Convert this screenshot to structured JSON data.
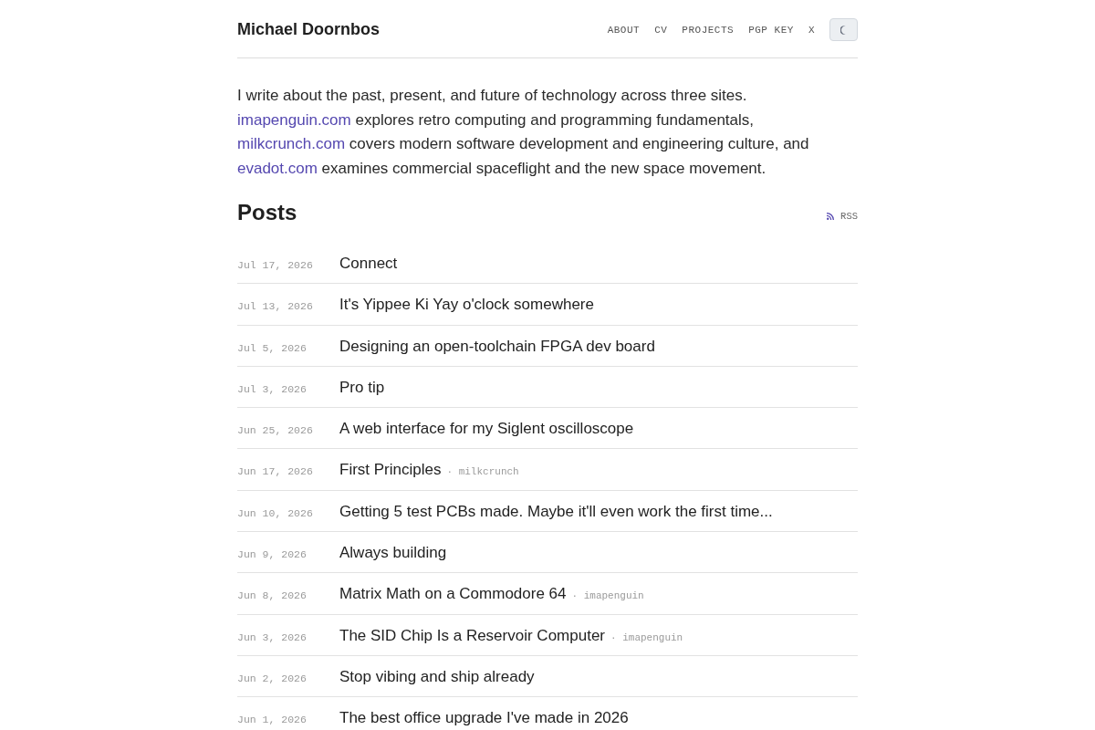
{
  "header": {
    "site_title": "Michael Doornbos",
    "nav": [
      {
        "label": "ABOUT"
      },
      {
        "label": "CV"
      },
      {
        "label": "PROJECTS"
      },
      {
        "label": "PGP KEY"
      },
      {
        "label": "X"
      }
    ]
  },
  "intro": [
    {
      "kind": "text",
      "text": "I write about the past, present, and future of technology across three sites. "
    },
    {
      "kind": "link",
      "text": "imapenguin.com"
    },
    {
      "kind": "text",
      "text": " explores retro computing and programming fundamentals, "
    },
    {
      "kind": "link",
      "text": "milkcrunch.com"
    },
    {
      "kind": "text",
      "text": " covers modern software development and engineering culture, and "
    },
    {
      "kind": "link",
      "text": "evadot.com"
    },
    {
      "kind": "text",
      "text": " examines commercial spaceflight and the new space movement."
    }
  ],
  "posts_section": {
    "title": "Posts",
    "rss_label": "RSS",
    "posts": [
      {
        "date": "Jul 17, 2026",
        "title": "Connect"
      },
      {
        "date": "Jul 13, 2026",
        "title": "It's Yippee Ki Yay o'clock somewhere"
      },
      {
        "date": "Jul 5, 2026",
        "title": "Designing an open-toolchain FPGA dev board"
      },
      {
        "date": "Jul 3, 2026",
        "title": "Pro tip"
      },
      {
        "date": "Jun 25, 2026",
        "title": "A web interface for my Siglent oscilloscope"
      },
      {
        "date": "Jun 17, 2026",
        "title": "First Principles",
        "site_tag": "· milkcrunch"
      },
      {
        "date": "Jun 10, 2026",
        "title": "Getting 5 test PCBs made. Maybe it'll even work the first time..."
      },
      {
        "date": "Jun 9, 2026",
        "title": "Always building"
      },
      {
        "date": "Jun 8, 2026",
        "title": "Matrix Math on a Commodore 64",
        "site_tag": "· imapenguin"
      },
      {
        "date": "Jun 3, 2026",
        "title": "The SID Chip Is a Reservoir Computer",
        "site_tag": "· imapenguin"
      },
      {
        "date": "Jun 2, 2026",
        "title": "Stop vibing and ship already"
      },
      {
        "date": "Jun 1, 2026",
        "title": "The best office upgrade I've made in 2026"
      }
    ]
  }
}
